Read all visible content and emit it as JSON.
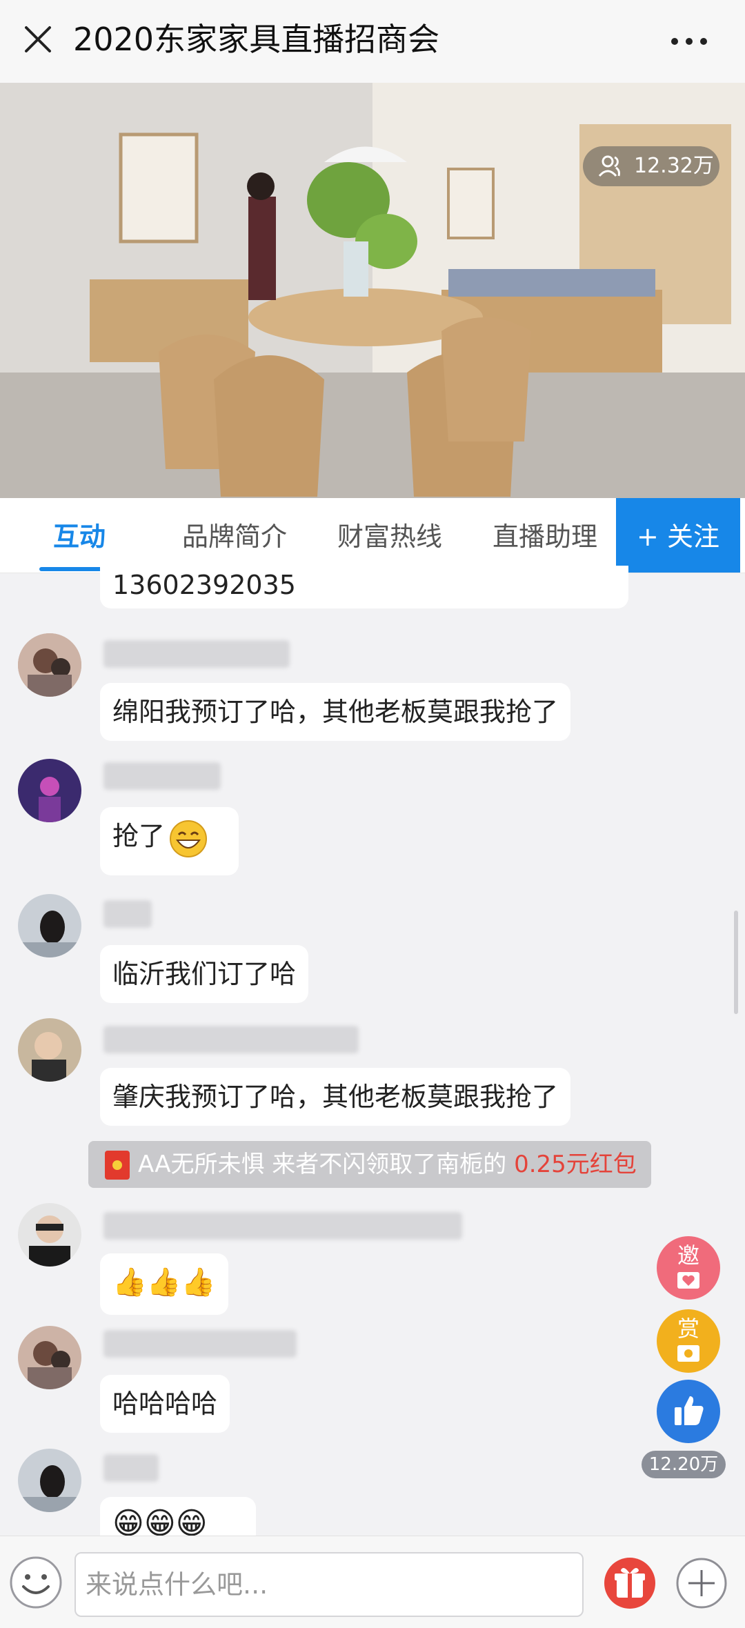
{
  "header": {
    "title": "2020东家家具直播招商会"
  },
  "video": {
    "viewer_count": "12.32万"
  },
  "tabs": [
    {
      "label": "互动"
    },
    {
      "label": "品牌简介"
    },
    {
      "label": "财富热线"
    },
    {
      "label": "直播助理"
    }
  ],
  "follow_label": "+ 关注",
  "messages": [
    {
      "text": "13602392035"
    },
    {
      "text": "绵阳我预订了哈，其他老板莫跟我抢了"
    },
    {
      "text": "抢了"
    },
    {
      "text": "临沂我们订了哈"
    },
    {
      "text": "肇庆我预订了哈，其他老板莫跟我抢了"
    },
    {
      "text": "👍👍👍"
    },
    {
      "text": "哈哈哈哈"
    },
    {
      "text": "😁😁😁"
    }
  ],
  "red_packet": {
    "text": "AA无所未惧 来者不闪领取了南栀的 ",
    "amount": "0.25元红包"
  },
  "side_actions": {
    "invite": "邀",
    "reward": "赏",
    "like_count": "12.20万"
  },
  "composer": {
    "placeholder": "来说点什么吧..."
  }
}
